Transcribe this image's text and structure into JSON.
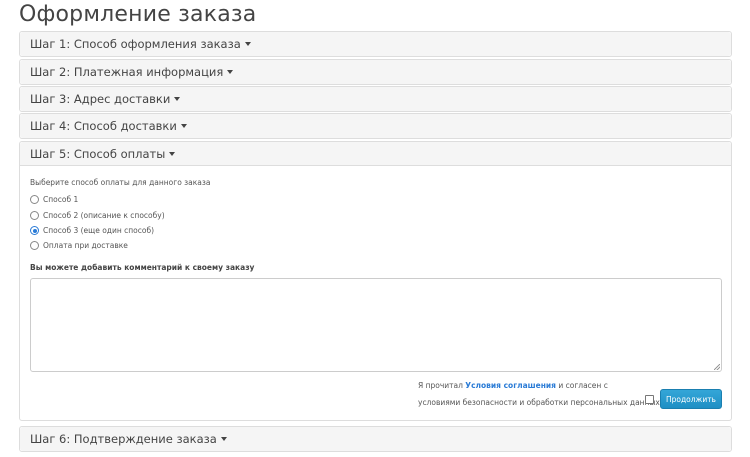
{
  "page": {
    "title": "Оформление заказа"
  },
  "steps": [
    {
      "label": "Шаг 1: Способ оформления заказа"
    },
    {
      "label": "Шаг 2: Платежная информация"
    },
    {
      "label": "Шаг 3: Адрес доставки"
    },
    {
      "label": "Шаг 4: Способ доставки"
    },
    {
      "label": "Шаг 5: Способ оплаты"
    },
    {
      "label": "Шаг 6: Подтверждение заказа"
    }
  ],
  "payment": {
    "hint": "Выберите способ оплаты для данного заказа",
    "options": [
      {
        "label": "Способ 1",
        "checked": false
      },
      {
        "label": "Способ 2 (описание к способу)",
        "checked": false
      },
      {
        "label": "Способ 3 (еще один способ)",
        "checked": true
      },
      {
        "label": "Оплата при доставке",
        "checked": false
      }
    ],
    "comment_label": "Вы можете добавить комментарий к своему заказу",
    "comment_value": ""
  },
  "agreement": {
    "prefix": "Я прочитал ",
    "link": "Условия соглашения",
    "suffix": " и согласен с",
    "line2": "условиями безопасности и обработки персональных данных",
    "checked": false
  },
  "buttons": {
    "continue": "Продолжить"
  },
  "colors": {
    "accent": "#2a9fd6",
    "panel_heading_bg": "#f5f5f5",
    "border": "#dddddd"
  }
}
